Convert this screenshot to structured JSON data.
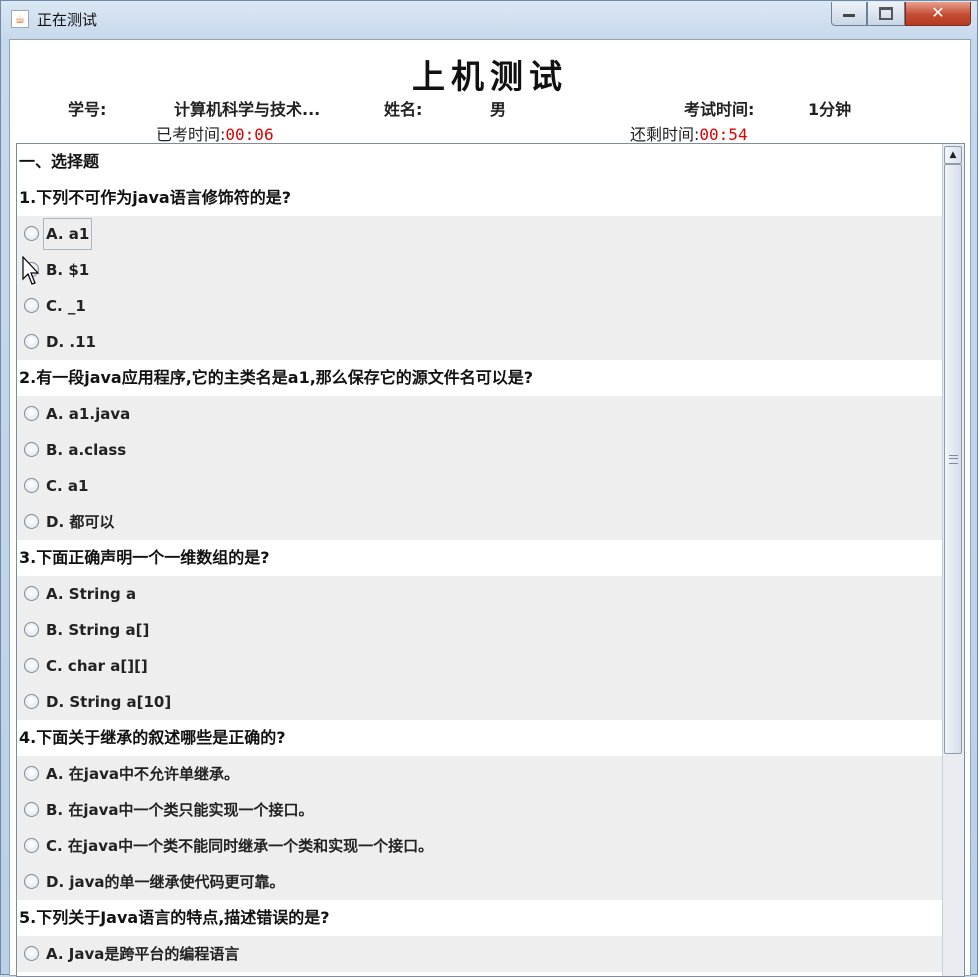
{
  "window": {
    "title": "正在测试",
    "app_icon": "java-cup-icon"
  },
  "header": {
    "title": "上机测试",
    "student_id_label": "学号:",
    "student_id_value": "计算机科学与技术...",
    "name_label": "姓名:",
    "name_value": "男",
    "exam_time_label": "考试时间:",
    "exam_time_value": "1分钟",
    "elapsed_label": "已考时间:",
    "elapsed_value": "00:06",
    "remaining_label": "还剩时间:",
    "remaining_value": "00:54"
  },
  "colors": {
    "timer": "#e00000",
    "option_bg": "#eeeeee"
  },
  "section_title": "一、选择题",
  "questions": [
    {
      "title": "1.下列不可作为java语言修饰符的是?",
      "options": [
        "A. a1",
        "B. $1",
        "C. _1",
        "D. .11"
      ]
    },
    {
      "title": "2.有一段java应用程序,它的主类名是a1,那么保存它的源文件名可以是?",
      "options": [
        "A. a1.java",
        "B. a.class",
        "C. a1",
        "D. 都可以"
      ]
    },
    {
      "title": "3.下面正确声明一个一维数组的是?",
      "options": [
        "A. String a",
        "B. String a[]",
        "C. char a[][]",
        "D. String a[10]"
      ]
    },
    {
      "title": "4.下面关于继承的叙述哪些是正确的?",
      "options": [
        "A. 在java中不允许单继承。",
        "B. 在java中一个类只能实现一个接口。",
        "C. 在java中一个类不能同时继承一个类和实现一个接口。",
        "D. java的单一继承使代码更可靠。"
      ]
    },
    {
      "title": "5.下列关于Java语言的特点,描述错误的是?",
      "options": [
        "A. Java是跨平台的编程语言"
      ]
    }
  ]
}
